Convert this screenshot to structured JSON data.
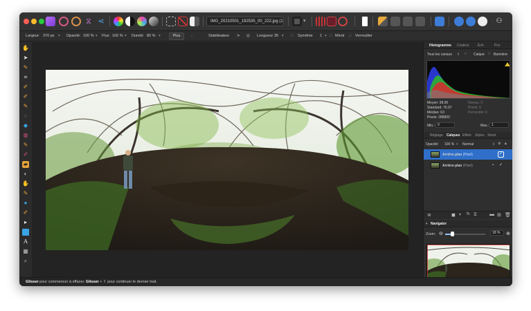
{
  "window": {
    "traffic_colors": [
      "#ff5f57",
      "#febc2e",
      "#28c840"
    ]
  },
  "toolbar": {
    "document_tab": "IMG_20210501_192535_00_222.jpg (17,7% ..."
  },
  "context_bar": {
    "width_label": "Largeur:",
    "width_value": "370 px",
    "opacity_label": "Opacité:",
    "opacity_value": "100 %",
    "flow_label": "Flux:",
    "flow_value": "100 %",
    "hardness_label": "Dureté:",
    "hardness_value": "80 %",
    "more_button": "Plus",
    "stabilizer_label": "Stabilisateur",
    "length_label": "Longueur",
    "length_value": "35",
    "symmetry_label": "Symétrie",
    "symmetry_value": "1",
    "mirror_label": "Miroir",
    "protect_alpha_label": "Verrouiller"
  },
  "histogram_panel": {
    "tabs": [
      "Histogramme",
      "Couleur",
      "Éch",
      "Pcx"
    ],
    "channel_select": "Tous les canaux",
    "layer_label": "Calque",
    "warnings_label": "Bannière",
    "stats": {
      "mean": "Moyen: 98.90",
      "std": "Standard: 76.97",
      "median": "Médian: 63",
      "pixels": "Pixels: 288800",
      "level": "Niveau: 0",
      "count": "Pixels: 0",
      "percentile": "Percentile: 0"
    },
    "min_label": "Min.:",
    "min_value": "0",
    "max_label": "Max.:",
    "max_value": "1"
  },
  "layers_panel": {
    "tabs": [
      "Réglage",
      "Calques",
      "Effets",
      "Styles",
      "Stock"
    ],
    "opacity_label": "Opacité:",
    "opacity_value": "100 %",
    "blend_mode": "Normal",
    "layers": [
      {
        "name": "Arrière-plan",
        "kind": "(Pixel)",
        "selected": true
      },
      {
        "name": "Arrière-plan",
        "kind": "(Pixel)",
        "selected": false
      }
    ]
  },
  "navigator_panel": {
    "title": "Navigator",
    "zoom_label": "Zoom:",
    "zoom_value": "18 %",
    "zoom_level": 0.18
  },
  "status_bar": {
    "drag_1": "Glisser",
    "text_1": " pour commencer à effacer. ",
    "drag_2": "Glisser",
    "text_2": " + ⇧ pour continuer le dernier trait."
  }
}
